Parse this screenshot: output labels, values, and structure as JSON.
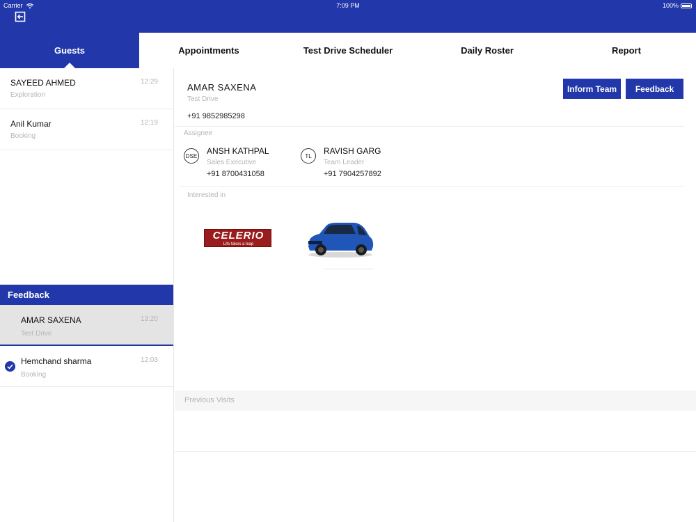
{
  "status_bar": {
    "carrier": "Carrier",
    "time": "7:09 PM",
    "battery": "100%"
  },
  "header": {
    "exit_icon": "exit-icon"
  },
  "tabs": [
    {
      "label": "Guests"
    },
    {
      "label": "Appointments"
    },
    {
      "label": "Test Drive Scheduler"
    },
    {
      "label": "Daily Roster"
    },
    {
      "label": "Report"
    }
  ],
  "guests": [
    {
      "name": "SAYEED  AHMED",
      "sub": "Exploration",
      "time": "12:29"
    },
    {
      "name": "Anil  Kumar",
      "sub": "Booking",
      "time": "12:19"
    }
  ],
  "feedback": {
    "title": "Feedback",
    "items": [
      {
        "name": "AMAR  SAXENA",
        "sub": "Test Drive",
        "time": "13:20"
      },
      {
        "name": "Hemchand  sharma",
        "sub": "Booking",
        "time": "12:03"
      }
    ]
  },
  "detail": {
    "name": "AMAR  SAXENA",
    "sub": "Test Drive",
    "phone": "+91 9852985298",
    "inform_label": "Inform Team",
    "feedback_label": "Feedback",
    "assignee_label": "Assignee",
    "assignees": [
      {
        "badge": "DSE",
        "name": "ANSH KATHPAL",
        "role": "Sales Executive",
        "phone": "+91 8700431058"
      },
      {
        "badge": "TL",
        "name": "RAVISH GARG",
        "role": "Team Leader",
        "phone": "+91 7904257892"
      }
    ],
    "interested_label": "Interested in",
    "model_logo": {
      "brand": "CELERIO",
      "tagline": "Life takes a leap"
    },
    "previous_visits_label": "Previous Visits"
  },
  "colors": {
    "brand_blue": "#2237a9",
    "logo_red": "#9b1c1c",
    "car_blue": "#1f56b8"
  }
}
